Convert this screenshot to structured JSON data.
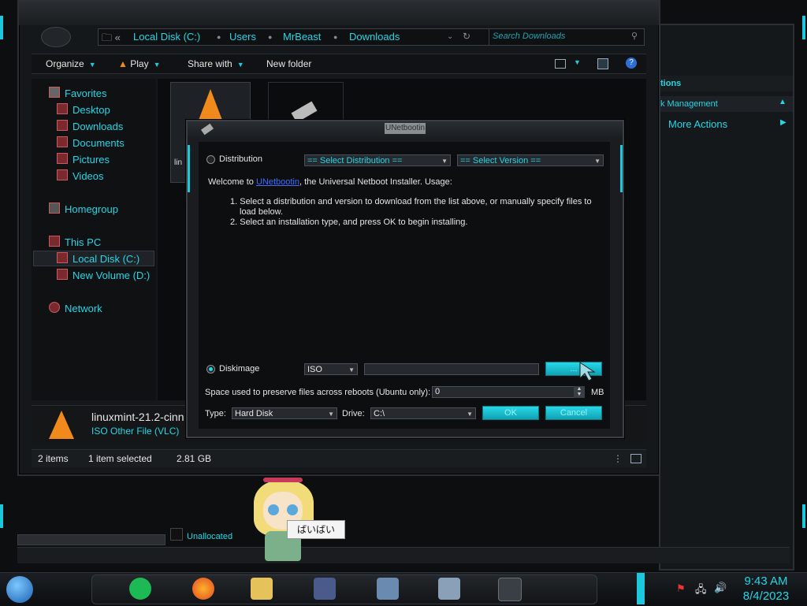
{
  "explorer": {
    "breadcrumb": [
      "Local Disk (C:)",
      "Users",
      "MrBeast",
      "Downloads"
    ],
    "search_placeholder": "Search Downloads",
    "commands": {
      "organize": "Organize",
      "play": "Play",
      "share": "Share with",
      "new_folder": "New folder"
    },
    "nav": {
      "favorites": "Favorites",
      "desktop": "Desktop",
      "downloads": "Downloads",
      "documents": "Documents",
      "pictures": "Pictures",
      "videos": "Videos",
      "homegroup": "Homegroup",
      "this_pc": "This PC",
      "local_disk": "Local Disk (C:)",
      "new_volume": "New Volume (D:)",
      "network": "Network"
    },
    "file_label_partial": "lin",
    "details": {
      "name": "linuxmint-21.2-cinn",
      "type": "ISO Other File (VLC)"
    },
    "status": {
      "items": "2 items",
      "selected": "1 item selected",
      "size": "2.81 GB"
    }
  },
  "right_panel": {
    "header": "tions",
    "item1": "k Management",
    "item2": "More Actions",
    "unallocated": "Unallocated"
  },
  "dialog": {
    "title": "UNetbootin",
    "distribution_label": "Distribution",
    "select_distribution": "== Select Distribution ==",
    "select_version": "== Select Version ==",
    "welcome_prefix": "Welcome to ",
    "welcome_link": "UNetbootin",
    "welcome_suffix": ", the Universal Netboot Installer. Usage:",
    "step1": "1. Select a distribution and version to download from the list above, or manually specify files to load below.",
    "step2": "2. Select an installation type, and press OK to begin installing.",
    "diskimage_label": "Diskimage",
    "diskimage_type": "ISO",
    "browse": "...",
    "space_label": "Space used to preserve files across reboots (Ubuntu only):",
    "space_value": "0",
    "space_unit": "MB",
    "type_label": "Type:",
    "type_value": "Hard Disk",
    "drive_label": "Drive:",
    "drive_value": "C:\\",
    "ok": "OK",
    "cancel": "Cancel"
  },
  "sticker_text": "ばいばい",
  "clock": {
    "time": "9:43 AM",
    "date": "8/4/2023"
  },
  "colors": {
    "accent": "#25d6e6",
    "window": "#15181b",
    "dialog_bg": "#0d0e0f"
  }
}
